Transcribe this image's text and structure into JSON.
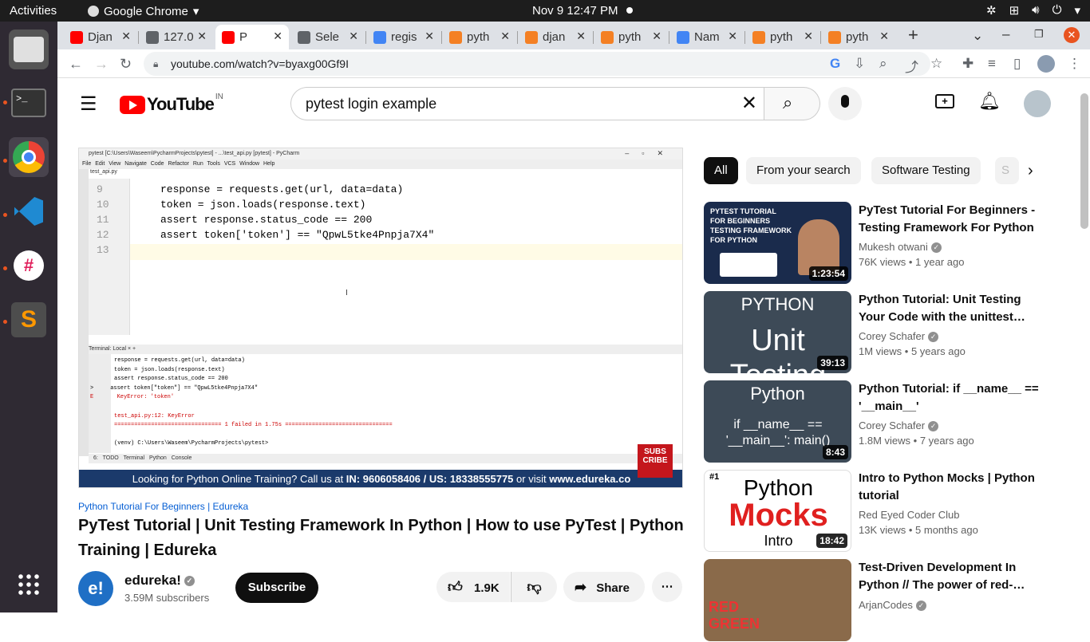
{
  "topbar": {
    "activities": "Activities",
    "app_name": "Google Chrome",
    "clock": "Nov 9  12:47 PM"
  },
  "tabs": [
    {
      "label": "Djan",
      "icon_color": "#ff0000"
    },
    {
      "label": "127.0",
      "icon_color": "#5f6368"
    },
    {
      "label": "P",
      "icon_color": "#ff0000"
    },
    {
      "label": "Sele",
      "icon_color": "#5f6368"
    },
    {
      "label": "regis",
      "icon_color": "#4285f4"
    },
    {
      "label": "pyth",
      "icon_color": "#f48024"
    },
    {
      "label": "djan",
      "icon_color": "#f48024"
    },
    {
      "label": "pyth",
      "icon_color": "#f48024"
    },
    {
      "label": "Nam",
      "icon_color": "#4285f4"
    },
    {
      "label": "pyth",
      "icon_color": "#f48024"
    },
    {
      "label": "pyth",
      "icon_color": "#f48024"
    }
  ],
  "address_bar": {
    "url": "youtube.com/watch?v=byaxg00Gf9I"
  },
  "youtube": {
    "logo_text": "YouTube",
    "region": "IN",
    "search_query": "pytest login example"
  },
  "player": {
    "ide_title": "pytest [C:\\Users\\Waseem\\PycharmProjects\\pytest] - ...\\test_api.py [pytest] - PyCharm",
    "ide_menu": "File Edit View Navigate Code Refactor Run Tools VCS Window Help",
    "file_tab": "test_api.py",
    "code_lines": [
      {
        "num": "9",
        "text": "response = requests.get(url, data=data)"
      },
      {
        "num": "10",
        "text": "token = json.loads(response.text)"
      },
      {
        "num": "11",
        "text": "assert response.status_code == 200"
      },
      {
        "num": "12",
        "text": "assert token['token'] == \"QpwL5tke4Pnpja7X4\""
      },
      {
        "num": "13",
        "text": ""
      }
    ],
    "terminal_tabs": "Terminal:   Local  ×   +",
    "terminal_lines": [
      "response = requests.get(url, data=data)",
      "token = json.loads(response.text)",
      "assert response.status_code == 200",
      ">     assert token[\"token\"] == \"QpwL5tke4Pnpja7X4\"",
      "E       KeyError: 'token'",
      "",
      "test_api.py:12: KeyError",
      "================================ 1 failed in 1.75s ================================",
      "",
      "(venv) C:\\Users\\Waseem\\PycharmProjects\\pytest>"
    ],
    "status_bar": "6: TODO   Terminal   Python Console",
    "banner_prefix": "Looking for Python Online Training? Call us at ",
    "banner_phone": "IN: 9606058406 / US: 18338555775",
    "banner_mid": " or visit ",
    "banner_site": "www.edureka.co",
    "badge": "SUBS CRIBE"
  },
  "video": {
    "playlist_link": "Python Tutorial For Beginners | Edureka",
    "title": "PyTest Tutorial | Unit Testing Framework In Python | How to use PyTest | Python Training | Edureka",
    "channel_avatar": "e!",
    "channel_name": "edureka!",
    "subscribers": "3.59M subscribers",
    "subscribe_label": "Subscribe",
    "likes": "1.9K",
    "share_label": "Share"
  },
  "chips": [
    "All",
    "From your search",
    "Software Testing",
    "S"
  ],
  "recommendations": [
    {
      "title": "PyTest Tutorial For Beginners - Testing Framework For Python",
      "channel": "Mukesh otwani",
      "views": "76K views",
      "age": "1 year ago",
      "duration": "1:23:54",
      "thumb_text": "PYTEST TUTORIAL FOR BEGINNERS TESTING FRAMEWORK FOR PYTHON",
      "thumb_bg": "#1a2b4c"
    },
    {
      "title": "Python Tutorial: Unit Testing Your Code with the unittest…",
      "channel": "Corey Schafer",
      "views": "1M views",
      "age": "5 years ago",
      "duration": "39:13",
      "thumb_text": "Unit Testing",
      "thumb_top": "PYTHON",
      "thumb_bg": "#3d4a57"
    },
    {
      "title": "Python Tutorial: if __name__ == '__main__'",
      "channel": "Corey Schafer",
      "views": "1.8M views",
      "age": "7 years ago",
      "duration": "8:43",
      "thumb_text": "if __name__ == '__main__': main()",
      "thumb_top": "Python",
      "thumb_bg": "#3d4a57"
    },
    {
      "title": "Intro to Python Mocks | Python tutorial",
      "channel": "Red Eyed Coder Club",
      "views": "13K views",
      "age": "5 months ago",
      "duration": "18:42",
      "thumb_text": "Mocks",
      "thumb_top": "Python",
      "thumb_bottom": "Intro",
      "thumb_rank": "#1",
      "thumb_bg": "#ffffff"
    },
    {
      "title": "Test-Driven Development In Python // The power of red-…",
      "channel": "ArjanCodes",
      "views": "",
      "age": "",
      "duration": "",
      "thumb_text": "RED GREEN",
      "thumb_bg": "#8a6a4a"
    }
  ]
}
